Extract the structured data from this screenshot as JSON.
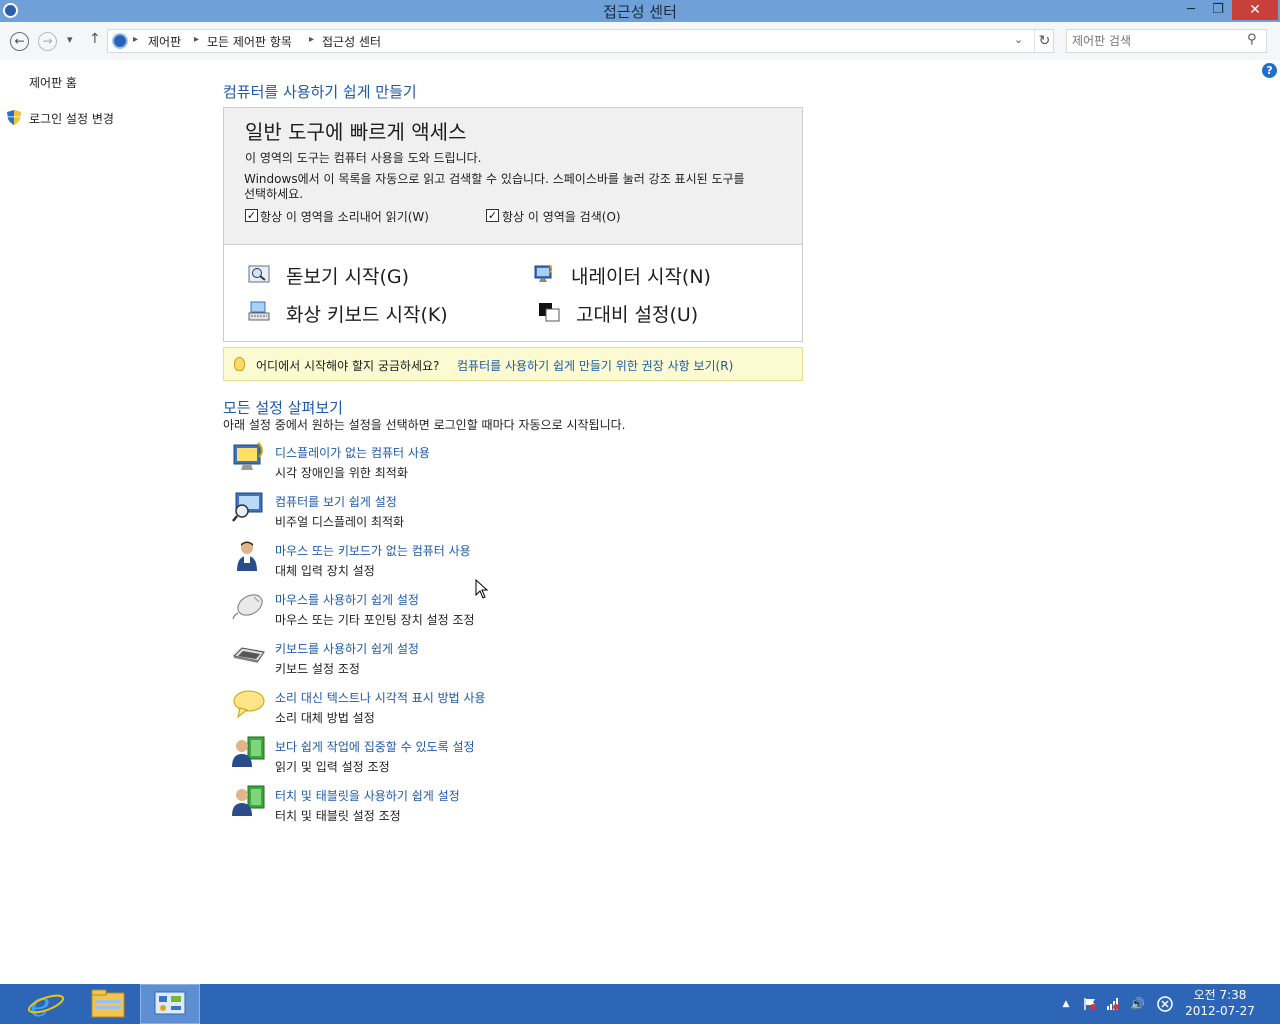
{
  "window": {
    "title": "접근성 센터",
    "min": "─",
    "max": "❐",
    "close": "✕"
  },
  "nav": {
    "back": "←",
    "forward": "→",
    "recent": "▾",
    "up": "↑",
    "breadcrumbs": [
      "제어판",
      "모든 제어판 항목",
      "접근성 센터"
    ],
    "separator": "▸",
    "dropdown": "⌄",
    "refresh": "↻",
    "search_placeholder": "제어판 검색",
    "search_icon": "⚲"
  },
  "help": "?",
  "sidebar": {
    "home": "제어판 홈",
    "login": "로그인 설정 변경"
  },
  "main": {
    "heading": "컴퓨터를 사용하기 쉽게 만들기",
    "quick": {
      "title": "일반 도구에 빠르게 액세스",
      "desc1": "이 영역의 도구는 컴퓨터 사용을 도와 드립니다.",
      "desc2a": "Windows에서 이 목록을 자동으로 읽고 검색할 수 있습니다. 스페이스바를 눌러 강조 표시된 도구를",
      "desc2b": "선택하세요.",
      "check1": "항상 이 영역을 소리내어 읽기(W)",
      "check2": "항상 이 영역을 검색(O)",
      "check_mark": "✓",
      "tools": {
        "magnifier": "돋보기 시작(G)",
        "narrator": "내레이터 시작(N)",
        "keyboard": "화상 키보드 시작(K)",
        "contrast": "고대비 설정(U)"
      }
    },
    "tip": {
      "text": "어디에서 시작해야 할지 궁금하세요?",
      "link": "컴퓨터를 사용하기 쉽게 만들기 위한 권장 사항 보기(R)"
    },
    "all": {
      "heading": "모든 설정 살펴보기",
      "desc": "아래 설정 중에서 원하는 설정을 선택하면 로그인할 때마다 자동으로 시작됩니다.",
      "items": [
        {
          "link": "디스플레이가 없는 컴퓨터 사용",
          "desc": "시각 장애인을 위한 최적화"
        },
        {
          "link": "컴퓨터를 보기 쉽게 설정",
          "desc": "비주얼 디스플레이 최적화"
        },
        {
          "link": "마우스 또는 키보드가 없는 컴퓨터 사용",
          "desc": "대체 입력 장치 설정"
        },
        {
          "link": "마우스를 사용하기 쉽게 설정",
          "desc": "마우스 또는 기타 포인팅 장치 설정 조정"
        },
        {
          "link": "키보드를 사용하기 쉽게 설정",
          "desc": "키보드 설정 조정"
        },
        {
          "link": "소리 대신 텍스트나 시각적 표시 방법 사용",
          "desc": "소리 대체 방법 설정"
        },
        {
          "link": "보다 쉽게 작업에 집중할 수 있도록 설정",
          "desc": "읽기 및 입력 설정 조정"
        },
        {
          "link": "터치 및 태블릿을 사용하기 쉽게 설정",
          "desc": "터치 및 태블릿 설정 조정"
        }
      ]
    }
  },
  "taskbar": {
    "tray_arrow": "▲",
    "volume": "🔊",
    "time": "오전 7:38",
    "date": "2012-07-27"
  }
}
